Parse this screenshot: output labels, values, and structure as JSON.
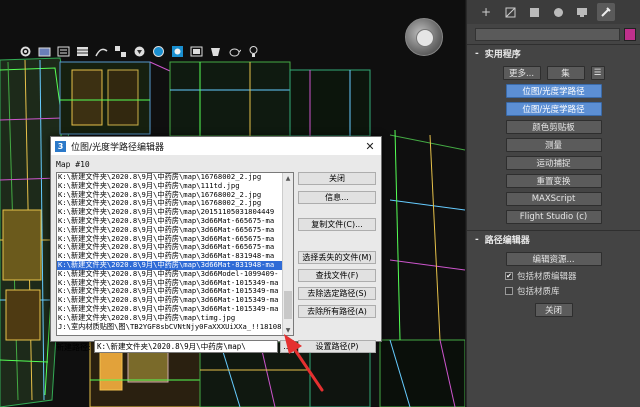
{
  "dialog": {
    "title": "位图/光度学路径编辑器",
    "logo": "3",
    "map_label": "Map #10",
    "paths": [
      "K:\\新建文件夹\\2020.8\\9月\\中药房\\map\\16768002_2.jpg",
      "K:\\新建文件夹\\2020.8\\9月\\中药房\\map\\111td.jpg",
      "K:\\新建文件夹\\2020.8\\9月\\中药房\\map\\16768002_2.jpg",
      "K:\\新建文件夹\\2020.8\\9月\\中药房\\map\\16768002_2.jpg",
      "K:\\新建文件夹\\2020.8\\9月\\中药房\\map\\20151105031804449",
      "K:\\新建文件夹\\2020.8\\9月\\中药房\\map\\3d66Mat-665675-ma",
      "K:\\新建文件夹\\2020.8\\9月\\中药房\\map\\3d66Mat-665675-ma",
      "K:\\新建文件夹\\2020.8\\9月\\中药房\\map\\3d66Mat-665675-ma",
      "K:\\新建文件夹\\2020.8\\9月\\中药房\\map\\3d66Mat-665675-ma",
      "K:\\新建文件夹\\2020.8\\9月\\中药房\\map\\3d66Mat-831948-ma",
      "K:\\新建文件夹\\2020.8\\9月\\中药房\\map\\3d66Mat-831948-ma",
      "K:\\新建文件夹\\2020.8\\9月\\中药房\\map\\3d66Model-1099409-",
      "K:\\新建文件夹\\2020.8\\9月\\中药房\\map\\3d66Mat-1015349-ma",
      "K:\\新建文件夹\\2020.8\\9月\\中药房\\map\\3d66Mat-1015349-ma",
      "K:\\新建文件夹\\2020.8\\9月\\中药房\\map\\3d66Mat-1015349-ma",
      "K:\\新建文件夹\\2020.8\\9月\\中药房\\map\\3d66Mat-1015349-ma",
      "K:\\新建文件夹\\2020.8\\9月\\中药房\\map\\timg.jpg",
      "J:\\室内材质贴图\\图\\TB2YGF8sbCVNtNjy0FaXXXUiXXa_!!18108"
    ],
    "selected_index": 10,
    "buttons": {
      "close": "关闭",
      "info": "信息...",
      "copy_files": "复制文件(C)...",
      "select_missing": "选择丢失的文件(M)",
      "find_files": "查找文件(F)",
      "strip_selected": "去除选定路径(S)",
      "strip_all": "去除所有路径(A)",
      "set_path": "设置路径(P)"
    },
    "new_path_label": "新建路径:",
    "new_path_value": "K:\\新建文件夹\\2020.8\\9月\\中药房\\map\\",
    "browse_label": "..."
  },
  "panel": {
    "utilities": {
      "header": "实用程序",
      "more": "更多...",
      "sets": "集",
      "items": [
        "位图/光度学路径",
        "位图/光度学路径",
        "颜色剪贴板",
        "测量",
        "运动捕捉",
        "重置变换",
        "MAXScript",
        "Flight Studio (c)"
      ],
      "selected": [
        0,
        1
      ]
    },
    "path_editor": {
      "header": "路径编辑器",
      "edit_resources": "编辑资源...",
      "include_material_editor": "包括材质编辑器",
      "include_material_library": "包括材质库",
      "include_material_editor_checked": true,
      "include_material_library_checked": false,
      "close": "关闭"
    },
    "minus_sign": "-"
  },
  "colors": {
    "accent": "#5c8fd4",
    "selection": "#2f6bd6",
    "arrow": "#e53030",
    "swatch": "#c0308c"
  },
  "icons": [
    "create-icon",
    "modify-icon",
    "hierarchy-icon",
    "motion-icon",
    "display-icon",
    "utilities-icon"
  ]
}
